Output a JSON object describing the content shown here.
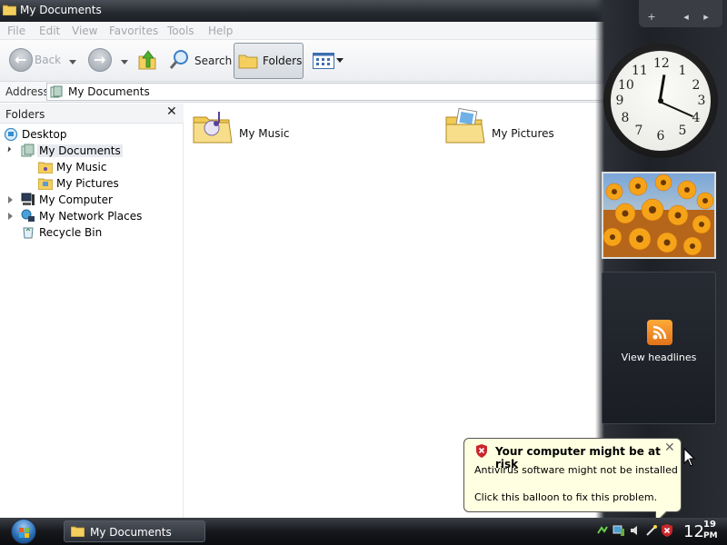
{
  "window": {
    "title": "My Documents"
  },
  "menu": [
    "File",
    "Edit",
    "View",
    "Favorites",
    "Tools",
    "Help"
  ],
  "toolbar": {
    "back_label": "Back",
    "search_label": "Search",
    "folders_label": "Folders"
  },
  "address": {
    "label": "Address",
    "value": "My Documents"
  },
  "folders_pane": {
    "title": "Folders",
    "items": [
      {
        "label": "Desktop"
      },
      {
        "label": "My Documents"
      },
      {
        "label": "My Music"
      },
      {
        "label": "My Pictures"
      },
      {
        "label": "My Computer"
      },
      {
        "label": "My Network Places"
      },
      {
        "label": "Recycle Bin"
      }
    ]
  },
  "content": {
    "items": [
      {
        "label": "My Music"
      },
      {
        "label": "My Pictures"
      }
    ]
  },
  "sidebar": {
    "clock_numbers": [
      "12",
      "1",
      "2",
      "3",
      "4",
      "5",
      "6",
      "7",
      "8",
      "9",
      "10",
      "11"
    ],
    "clock_time": {
      "hour": 12,
      "minute": 19
    },
    "feed_label": "View headlines"
  },
  "balloon": {
    "title": "Your computer might be at risk",
    "line1": "Antivirus software might not be installed",
    "line2": "Click this balloon to fix this problem."
  },
  "taskbar": {
    "task_label": "My Documents",
    "time_hour": "12",
    "time_minute": "19",
    "time_ampm": "PM"
  },
  "colors": {
    "accent": "#2b6fb6",
    "folder": "#f3d36b",
    "balloon_bg": "#ffffe1",
    "rss": "#f08a24"
  }
}
